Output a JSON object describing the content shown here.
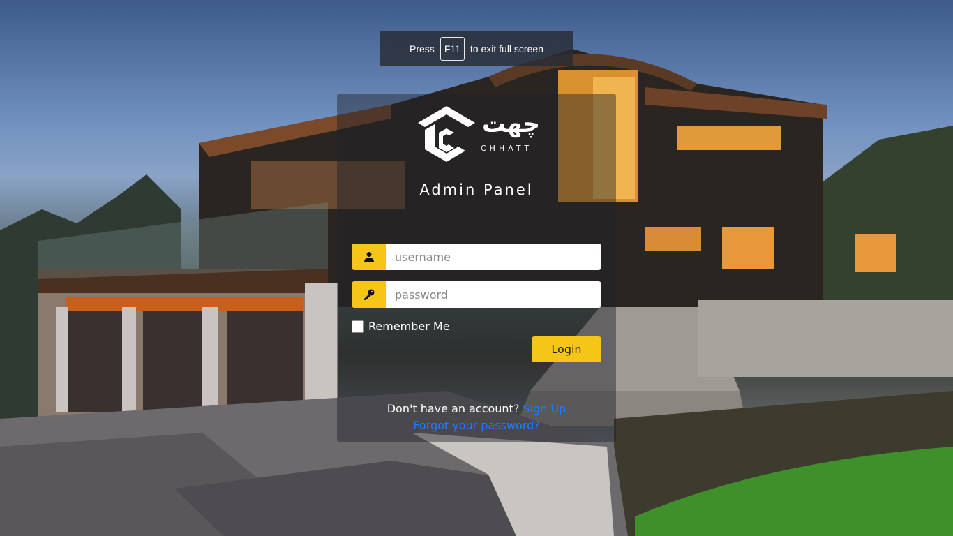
{
  "fullscreen_notice": {
    "before": "Press",
    "key": "F11",
    "after": "to exit full screen"
  },
  "brand": {
    "urdu_name": "چھت",
    "latin_name": "CHHATT"
  },
  "panel": {
    "title": "Admin Panel"
  },
  "form": {
    "username_placeholder": "username",
    "password_placeholder": "password",
    "remember_label": "Remember Me",
    "login_label": "Login"
  },
  "footer": {
    "no_account_text": "Don't have an account?",
    "signup_label": "Sign Up",
    "forgot_label": "Forgot your password?"
  },
  "colors": {
    "accent": "#f5c518",
    "link": "#1e7bff"
  },
  "icons": {
    "username": "user-icon",
    "password": "key-icon"
  }
}
